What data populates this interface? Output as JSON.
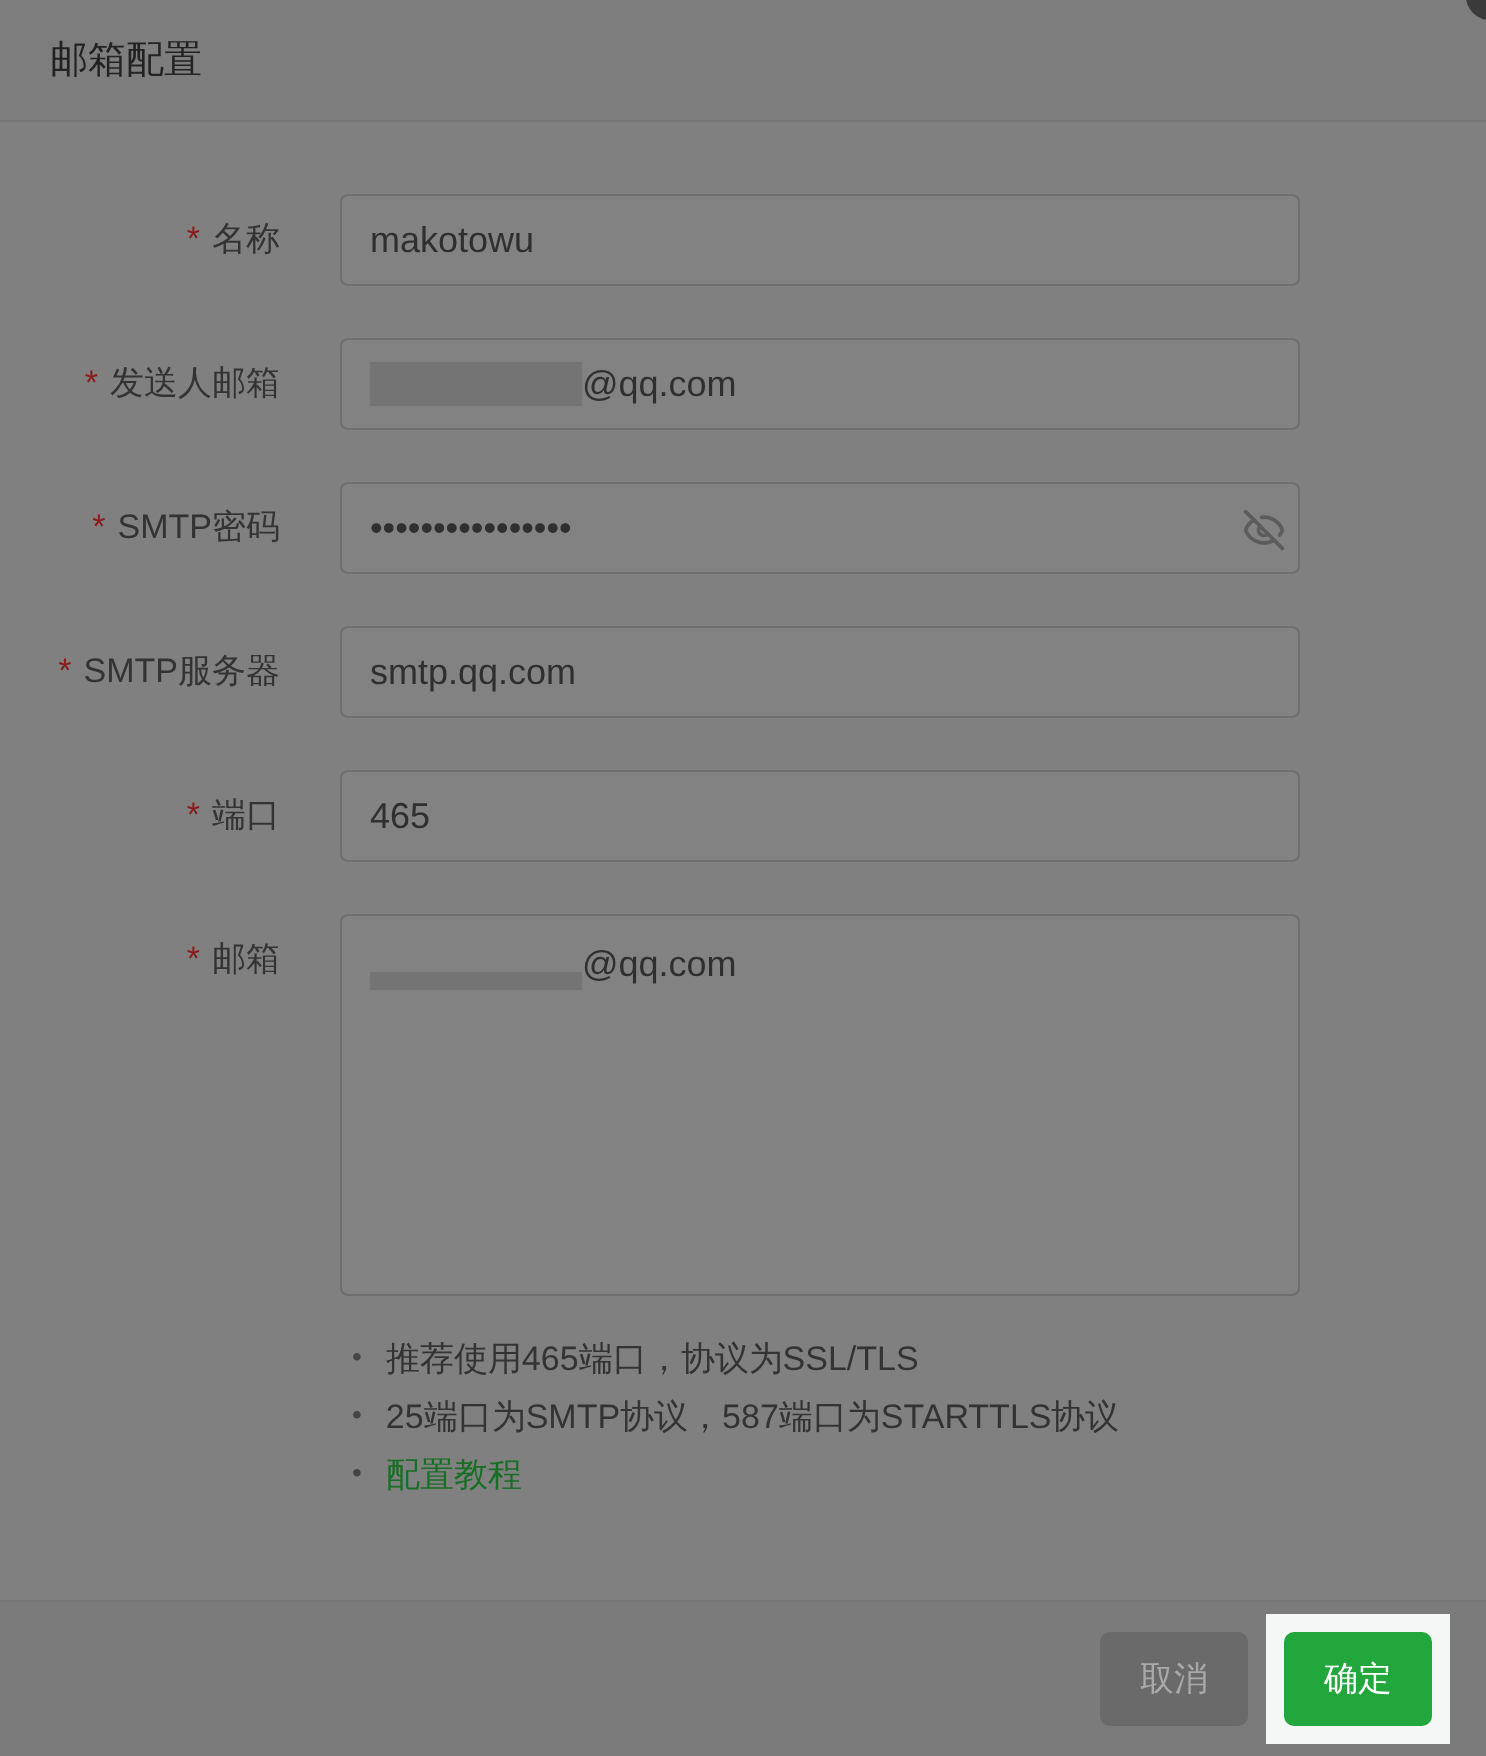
{
  "dialog": {
    "title": "邮箱配置"
  },
  "fields": [
    {
      "label": "名称",
      "required_mark": "*",
      "kind": "text",
      "value": "makotowu"
    },
    {
      "label": "发送人邮箱",
      "required_mark": "*",
      "kind": "text",
      "value": "@qq.com",
      "redacted": true
    },
    {
      "label": "SMTP密码",
      "required_mark": "*",
      "kind": "password",
      "value": "••••••••••••••••"
    },
    {
      "label": "SMTP服务器",
      "required_mark": "*",
      "kind": "text",
      "value": "smtp.qq.com"
    },
    {
      "label": "端口",
      "required_mark": "*",
      "kind": "text",
      "value": "465"
    },
    {
      "label": "邮箱",
      "required_mark": "*",
      "kind": "textarea",
      "value": "@qq.com",
      "redacted": true
    }
  ],
  "tips": [
    {
      "kind": "text",
      "bullet": "•",
      "text": "推荐使用465端口，协议为SSL/TLS"
    },
    {
      "kind": "text",
      "bullet": "•",
      "text": "25端口为SMTP协议，587端口为STARTTLS协议"
    },
    {
      "kind": "link",
      "bullet": "•",
      "text": "配置教程"
    }
  ],
  "buttons": [
    {
      "label": "取消",
      "kind": "secondary",
      "highlighted": false
    },
    {
      "label": "确定",
      "kind": "primary",
      "highlighted": true
    }
  ]
}
